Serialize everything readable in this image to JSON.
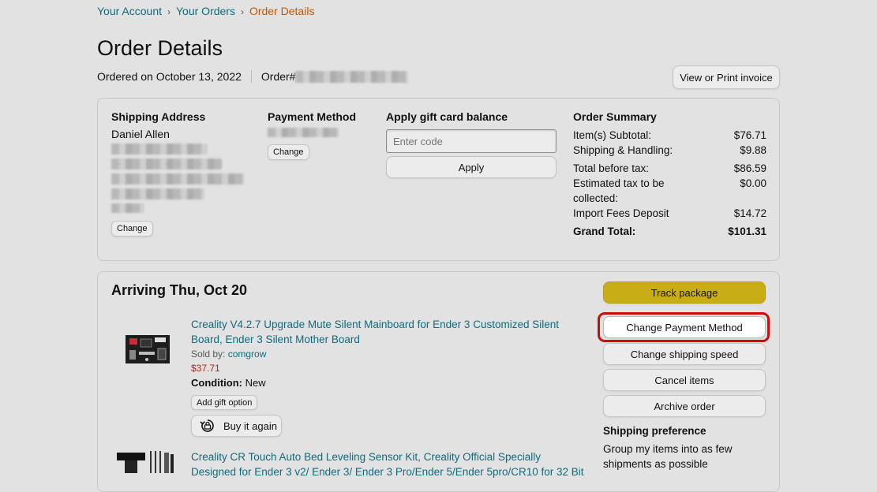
{
  "breadcrumb": {
    "items": [
      "Your Account",
      "Your Orders"
    ],
    "current": "Order Details",
    "separator": "›"
  },
  "page_title": "Order Details",
  "meta": {
    "ordered_on": "Ordered on October 13, 2022",
    "order_label": "Order#"
  },
  "invoice_button": "View or Print invoice",
  "shipping": {
    "heading": "Shipping Address",
    "name": "Daniel Allen",
    "change_label": "Change"
  },
  "payment": {
    "heading": "Payment Method",
    "change_label": "Change"
  },
  "gift_card": {
    "heading": "Apply gift card balance",
    "placeholder": "Enter code",
    "apply_label": "Apply"
  },
  "summary": {
    "heading": "Order Summary",
    "rows": [
      {
        "label": "Item(s) Subtotal:",
        "value": "$76.71"
      },
      {
        "label": "Shipping & Handling:",
        "value": "$9.88"
      },
      {
        "label": "Total before tax:",
        "value": "$86.59"
      },
      {
        "label": "Estimated tax to be collected:",
        "value": "$0.00"
      },
      {
        "label": "Import Fees Deposit",
        "value": "$14.72"
      }
    ],
    "grand_total_label": "Grand Total:",
    "grand_total_value": "$101.31"
  },
  "shipment": {
    "arriving": "Arriving Thu, Oct 20",
    "actions": {
      "track": "Track package",
      "change_payment": "Change Payment Method",
      "change_speed": "Change shipping speed",
      "cancel": "Cancel items",
      "archive": "Archive order"
    },
    "preference_heading": "Shipping preference",
    "preference_text": "Group my items into as few shipments as possible",
    "items": [
      {
        "title": "Creality V4.2.7 Upgrade Mute Silent Mainboard for Ender 3 Customized Silent Board, Ender 3 Silent Mother Board",
        "sold_by_label": "Sold by:",
        "seller": "comgrow",
        "price": "$37.71",
        "condition_label": "Condition:",
        "condition": "New",
        "gift_label": "Add gift option",
        "buy_again_label": "Buy it again"
      },
      {
        "title": "Creality CR Touch Auto Bed Leveling Sensor Kit, Creality Official Specially Designed for Ender 3 v2/ Ender 3/ Ender 3 Pro/Ender 5/Ender 5pro/CR10 for 32 Bit"
      }
    ]
  },
  "colors": {
    "link": "#0f6c7e",
    "breadcrumb_current": "#c45500",
    "track_button": "#c9ad16",
    "highlight": "#cc0c0c",
    "price": "#b12704"
  }
}
